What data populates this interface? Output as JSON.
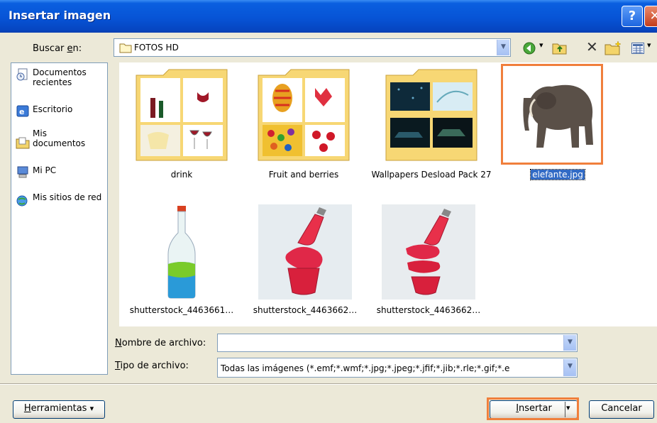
{
  "window": {
    "title": "Insertar imagen",
    "help_glyph": "?",
    "close_glyph": "✕"
  },
  "toolbar": {
    "lookin_label_prefix": "Buscar ",
    "lookin_label_key": "e",
    "lookin_label_suffix": "n:",
    "folder": "FOTOS HD",
    "back_glyph": "◀",
    "back_arrow": "▾",
    "delete_glyph": "✕",
    "view_arrow": "▾"
  },
  "places": [
    {
      "label": "Documentos recientes",
      "icon": "recent-documents-icon"
    },
    {
      "label": "Escritorio",
      "icon": "desktop-icon"
    },
    {
      "label": "Mis documentos",
      "icon": "my-documents-icon"
    },
    {
      "label": "Mi PC",
      "icon": "my-computer-icon"
    },
    {
      "label": "Mis sitios de red",
      "icon": "network-places-icon"
    }
  ],
  "files": [
    {
      "name": "drink",
      "type": "folder"
    },
    {
      "name": "Fruit and berries",
      "type": "folder"
    },
    {
      "name": "Wallpapers Desload Pack 27",
      "type": "folder"
    },
    {
      "name": "elefante.jpg",
      "type": "image",
      "selected": true
    },
    {
      "name": "shutterstock_4463661…",
      "type": "image"
    },
    {
      "name": "shutterstock_4463662…",
      "type": "image"
    },
    {
      "name": "shutterstock_4463662…",
      "type": "image"
    }
  ],
  "filename": {
    "label_key": "N",
    "label_rest": "ombre de archivo:",
    "value": ""
  },
  "filetype": {
    "label_key": "T",
    "label_rest": "ipo de archivo:",
    "value": "Todas las imágenes (*.emf;*.wmf;*.jpg;*.jpeg;*.jfif;*.jib;*.rle;*.gif;*.e"
  },
  "buttons": {
    "tools_key": "H",
    "tools_rest": "erramientas",
    "tools_arrow": "▾",
    "insert_key": "I",
    "insert_rest": "nsertar",
    "insert_arrow": "▾",
    "cancel": "Cancelar"
  },
  "colors": {
    "highlight": "#f07f3c",
    "selection": "#316ac5",
    "titlebar": "#0754d6"
  }
}
